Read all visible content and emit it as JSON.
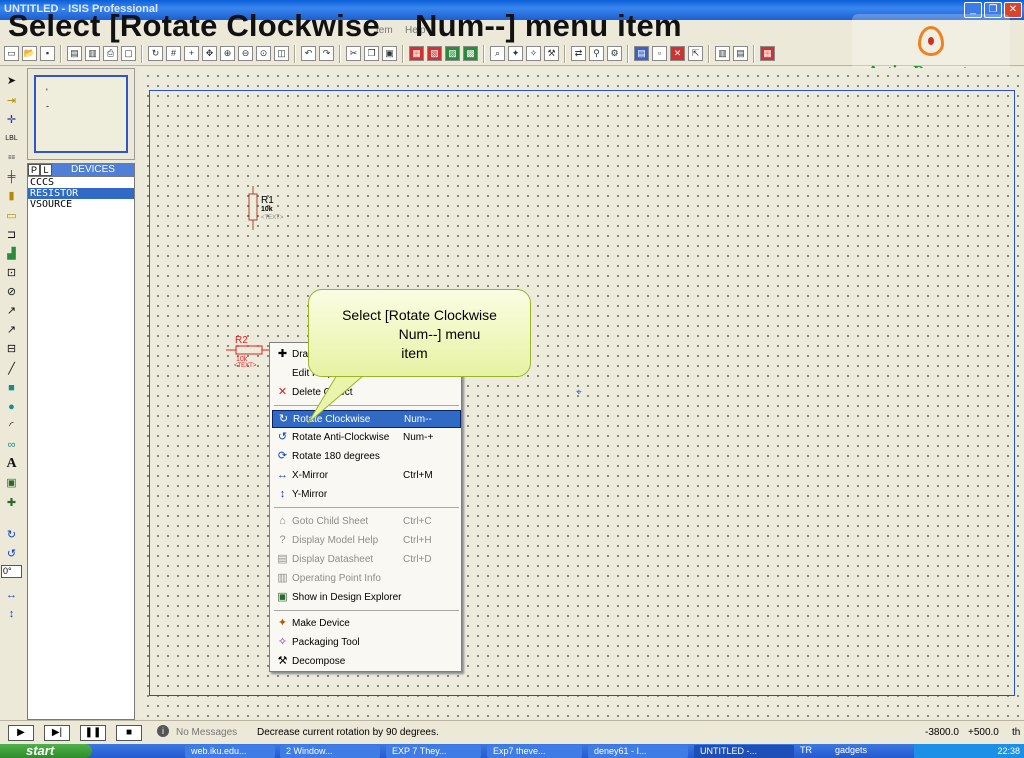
{
  "window": {
    "title": "UNTITLED - ISIS Professional"
  },
  "headline": "Select [Rotate Clockwise    Num--] menu item",
  "menubar": {
    "partial_items": [
      "tem",
      "Help"
    ]
  },
  "watermark": {
    "brand": "ActivePresenter"
  },
  "toolbar": {
    "icons": [
      "new-icon",
      "open-icon",
      "save-icon",
      "import-icon",
      "export-icon",
      "print-icon",
      "area-icon",
      "refresh-icon",
      "grid-icon",
      "origin-icon",
      "pan-icon",
      "zoom-in-icon",
      "zoom-out-icon",
      "zoom-all-icon",
      "zoom-area-icon",
      "undo-icon",
      "redo-icon",
      "cut-icon",
      "copy-icon",
      "paste-icon",
      "block-copy-icon",
      "block-move-icon",
      "block-rotate-icon",
      "block-delete-icon",
      "pick-device-icon",
      "make-device-icon",
      "packaging-icon",
      "decompose-icon",
      "wire-autorouter-icon",
      "search-icon",
      "property-tool-icon",
      "design-explorer-icon",
      "new-sheet-icon",
      "remove-sheet-icon",
      "exit-parent-icon",
      "bom-icon",
      "netlist-icon",
      "ares-icon"
    ]
  },
  "devices": {
    "tab_p": "P",
    "tab_l": "L",
    "header": "DEVICES",
    "items": [
      "CCCS",
      "RESISTOR",
      "VSOURCE"
    ],
    "selected": "RESISTOR"
  },
  "rotation": {
    "value": "0°"
  },
  "canvas": {
    "components": [
      {
        "ref": "R1",
        "value": "10k",
        "text": "<TEXT>"
      },
      {
        "ref": "R2",
        "value": "10k",
        "text": "<TEXT>"
      }
    ]
  },
  "context_menu": {
    "items": [
      {
        "label": "Drag Object",
        "shortcut": "",
        "icon": "move-icon",
        "disabled": false
      },
      {
        "label": "Edit Properties",
        "shortcut": "",
        "icon": "edit-icon",
        "disabled": false
      },
      {
        "label": "Delete Object",
        "shortcut": "",
        "icon": "delete-icon",
        "disabled": false
      },
      {
        "label": "Rotate Clockwise",
        "shortcut": "Num--",
        "icon": "rotate-clockwise-icon",
        "disabled": false,
        "highlighted": true
      },
      {
        "label": "Rotate Anti-Clockwise",
        "shortcut": "Num-+",
        "icon": "rotate-anticlockwise-icon",
        "disabled": false
      },
      {
        "label": "Rotate 180 degrees",
        "shortcut": "",
        "icon": "rotate-180-icon",
        "disabled": false
      },
      {
        "label": "X-Mirror",
        "shortcut": "Ctrl+M",
        "icon": "x-mirror-icon",
        "disabled": false
      },
      {
        "label": "Y-Mirror",
        "shortcut": "",
        "icon": "y-mirror-icon",
        "disabled": false
      },
      {
        "label": "Goto Child Sheet",
        "shortcut": "Ctrl+C",
        "icon": "child-sheet-icon",
        "disabled": true
      },
      {
        "label": "Display Model Help",
        "shortcut": "Ctrl+H",
        "icon": "help-icon",
        "disabled": true
      },
      {
        "label": "Display Datasheet",
        "shortcut": "Ctrl+D",
        "icon": "datasheet-icon",
        "disabled": true
      },
      {
        "label": "Operating Point Info",
        "shortcut": "",
        "icon": "op-info-icon",
        "disabled": true
      },
      {
        "label": "Show in Design Explorer",
        "shortcut": "",
        "icon": "design-explorer-icon",
        "disabled": false
      },
      {
        "label": "Make Device",
        "shortcut": "",
        "icon": "make-device-icon",
        "disabled": false
      },
      {
        "label": "Packaging Tool",
        "shortcut": "",
        "icon": "packaging-icon",
        "disabled": false
      },
      {
        "label": "Decompose",
        "shortcut": "",
        "icon": "decompose-icon",
        "disabled": false
      }
    ]
  },
  "callout": {
    "text_line1": "Select [Rotate Clockwise",
    "text_line2": "Num--] menu",
    "text_line3": "item"
  },
  "status": {
    "messages": "No Messages",
    "hint": "Decrease current rotation by 90 degrees.",
    "x": "-3800.0",
    "y": "+500.0",
    "unit": "th"
  },
  "taskbar": {
    "start": "start",
    "tasks": [
      "web.iku.edu...",
      "2 Window...",
      "EXP 7 They...",
      "Exp7 theve...",
      "deney61 - I...",
      "UNTITLED -..."
    ],
    "tray_lang": "TR",
    "tray_gadgets": "gadgets",
    "clock": "22:38"
  },
  "colors": {
    "accent": "#316ac5",
    "sheet_border": "#2a4fc8",
    "callout_fill": "#eef7b8",
    "brand": "#1e9a28"
  }
}
